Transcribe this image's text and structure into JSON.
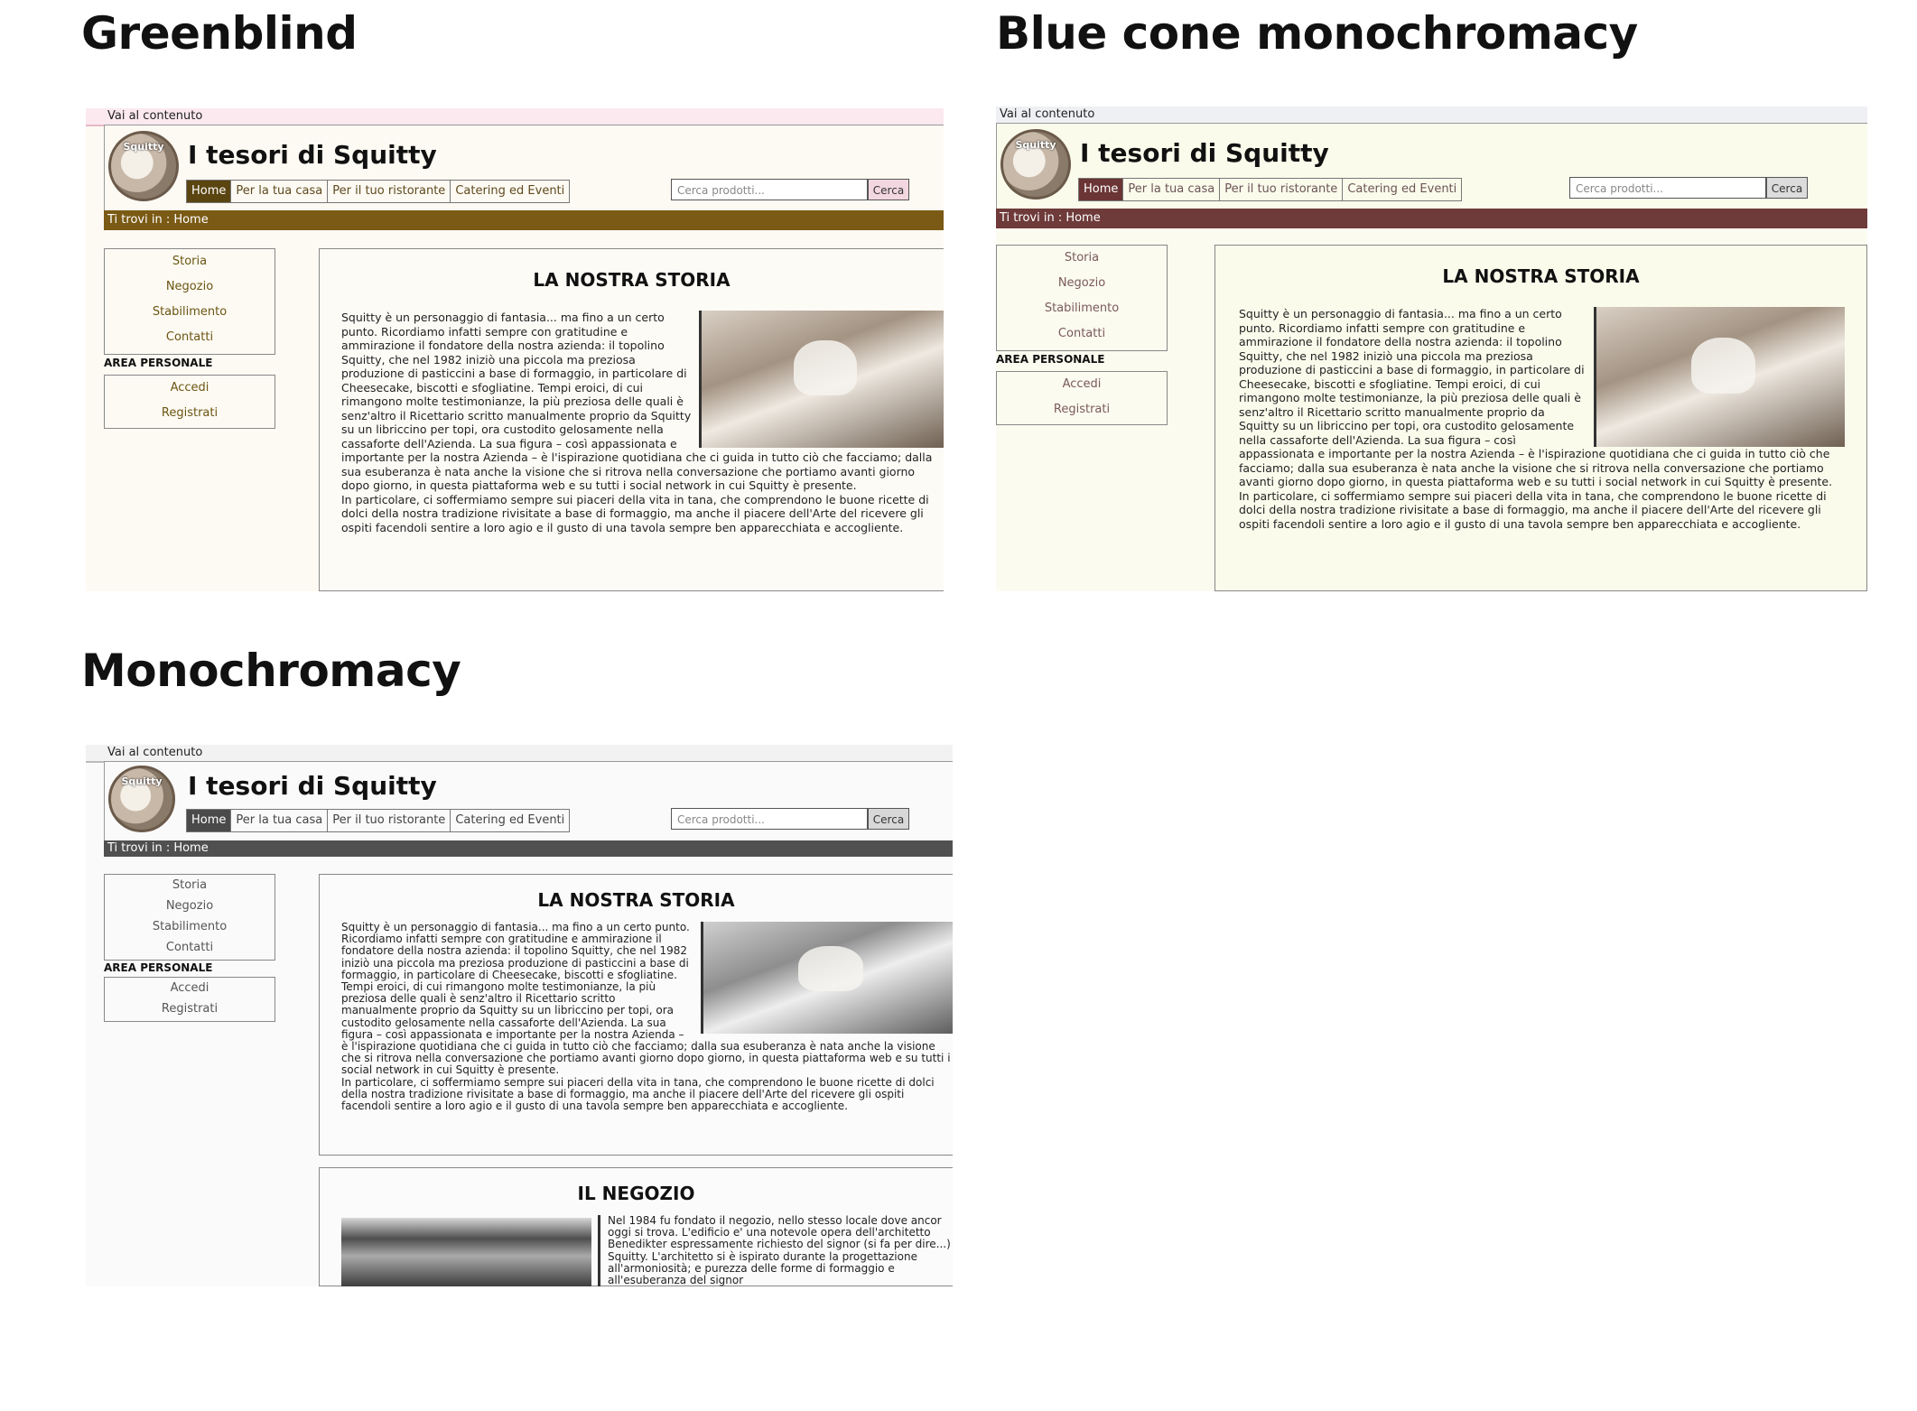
{
  "headings": {
    "greenblind": "Greenblind",
    "blue": "Blue cone monochromacy",
    "mono": "Monochromacy"
  },
  "site": {
    "skip_link": "Vai al contenuto",
    "logo_text": "Squitty",
    "title": "I tesori di Squitty",
    "nav": [
      "Home",
      "Per la tua casa",
      "Per il tuo ristorante",
      "Catering ed Eventi"
    ],
    "search_placeholder": "Cerca prodotti...",
    "search_button": "Cerca",
    "breadcrumb": "Ti trovi in : Home",
    "sidebar": [
      "Storia",
      "Negozio",
      "Stabilimento",
      "Contatti"
    ],
    "area_label": "AREA PERSONALE",
    "account": [
      "Accedi",
      "Registrati"
    ],
    "story_title": "LA NOSTRA STORIA",
    "story_p1": "Squitty è un personaggio di fantasia... ma fino a un certo punto. Ricordiamo infatti sempre con gratitudine e ammirazione il fondatore della nostra azienda: il topolino Squitty, che nel 1982 iniziò una piccola ma preziosa produzione di pasticcini a base di formaggio, in particolare di Cheesecake, biscotti e sfogliatine. Tempi eroici, di cui rimangono molte testimonianze, la più preziosa delle quali è senz'altro il Ricettario scritto manualmente proprio da Squitty su un libriccino per topi, ora custodito gelosamente nella cassaforte dell'Azienda. La sua figura – così appassionata e importante per la nostra Azienda – è l'ispirazione quotidiana che ci guida in tutto ciò che facciamo; dalla sua esuberanza è nata anche la visione che si ritrova nella conversazione che portiamo avanti giorno dopo giorno, in questa piattaforma web e su tutti i social network in cui Squitty è presente.",
    "story_p2": "In particolare, ci soffermiamo sempre sui piaceri della vita in tana, che comprendono le buone ricette di dolci della nostra tradizione rivisitate a base di formaggio, ma anche il piacere dell'Arte del ricevere gli ospiti facendoli sentire a loro agio e il gusto di una tavola sempre ben apparecchiata e accogliente.",
    "shop_title": "IL NEGOZIO",
    "shop_text": "Nel 1984 fu fondato il negozio, nello stesso locale dove ancor oggi si trova. L'edificio e' una notevole opera dell'architetto Benedikter espressamente richiesto del signor (si fa per dire...) Squitty. L'architetto si è ispirato durante la progettazione all'armoniosità; e purezza delle forme di formaggio e all'esuberanza del signor"
  }
}
